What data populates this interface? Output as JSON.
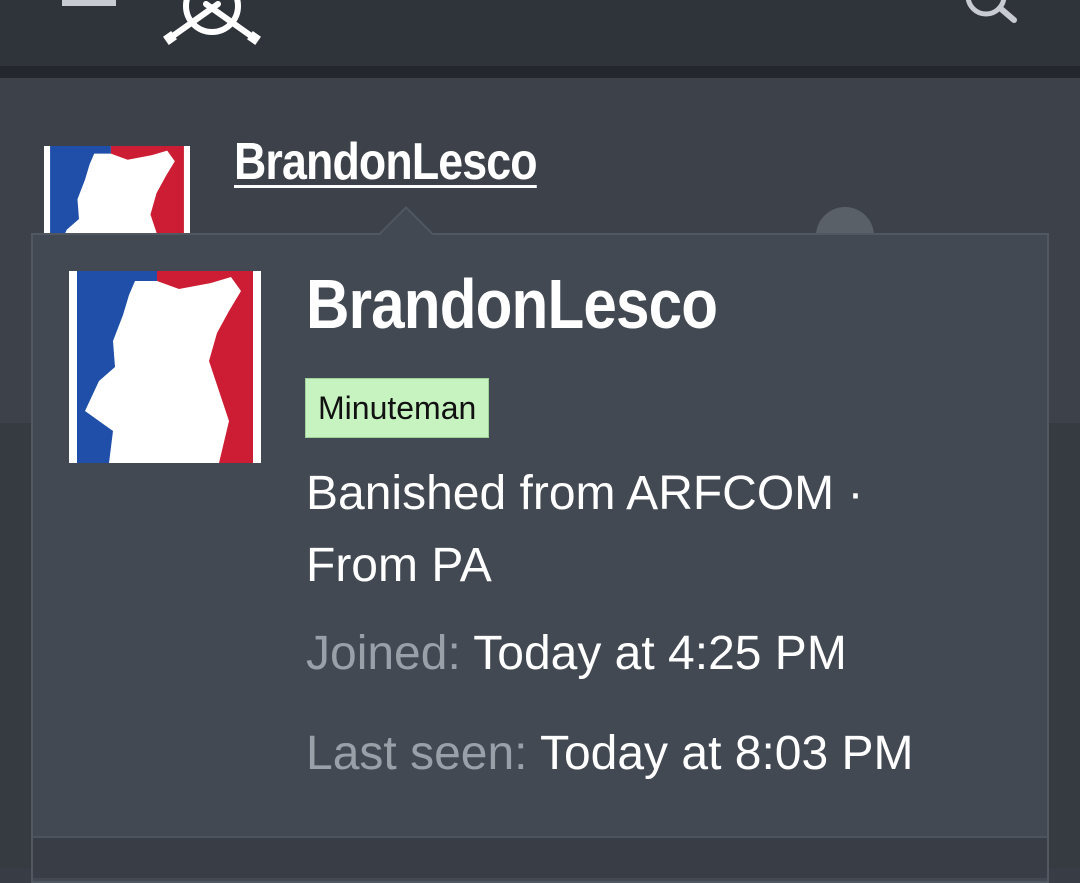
{
  "header": {
    "menu_icon": "hamburger-menu-icon",
    "logo_icon": "crossed-rifles-logo-icon",
    "search_icon": "search-icon"
  },
  "post": {
    "username": "BrandonLesco"
  },
  "member_card": {
    "username": "BrandonLesco",
    "badge": "Minuteman",
    "user_title": "Banished from ARFCOM · From PA",
    "joined_label": "Joined:",
    "joined_value": "Today at 4:25 PM",
    "last_seen_label": "Last seen:",
    "last_seen_value": "Today at 8:03 PM"
  },
  "colors": {
    "header_bg": "#2f343b",
    "card_bg": "#434952",
    "badge_bg": "#c7f3c1",
    "avatar_blue": "#1f4fa8",
    "avatar_red": "#cc1d34"
  }
}
